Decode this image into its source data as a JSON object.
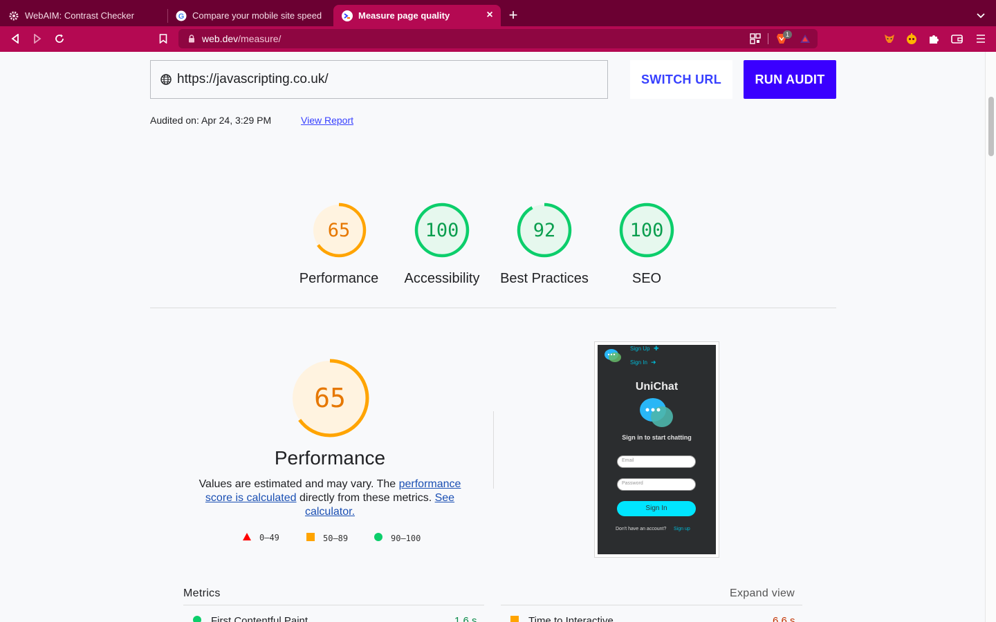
{
  "browser": {
    "tabs": [
      {
        "title": "WebAIM: Contrast Checker",
        "icon": "gear-favicon-icon"
      },
      {
        "title": "Compare your mobile site speed",
        "icon": "google-favicon-icon"
      },
      {
        "title": "Measure page quality",
        "icon": "webdev-favicon-icon",
        "active": true
      }
    ],
    "url_host": "web.dev",
    "url_path": "/measure/",
    "brave_badge": "1",
    "accent": "#b40952"
  },
  "audit": {
    "url_value": "https://javascripting.co.uk/",
    "switch_url_label": "SWITCH URL",
    "run_audit_label": "RUN AUDIT",
    "audited_on": "Audited on: Apr 24, 3:29 PM",
    "view_report": "View Report"
  },
  "scores": [
    {
      "label": "Performance",
      "score": "65",
      "value": 65,
      "color": "#ffa400",
      "bg": "#fff3e0"
    },
    {
      "label": "Accessibility",
      "score": "100",
      "value": 100,
      "color": "#0cce6b",
      "bg": "#e6f8ee"
    },
    {
      "label": "Best Practices",
      "score": "92",
      "value": 92,
      "color": "#0cce6b",
      "bg": "#e6f8ee"
    },
    {
      "label": "SEO",
      "score": "100",
      "value": 100,
      "color": "#0cce6b",
      "bg": "#e6f8ee"
    }
  ],
  "performance": {
    "score": "65",
    "value": 65,
    "title": "Performance",
    "desc_prefix": "Values are estimated and may vary. The ",
    "desc_link1": "performance score is calculated",
    "desc_middle": " directly from these metrics. ",
    "desc_link2": "See calculator.",
    "legend": [
      {
        "range": "0–49",
        "shape": "triangle",
        "color": "#ff0000"
      },
      {
        "range": "50–89",
        "shape": "square",
        "color": "#ffa400"
      },
      {
        "range": "90–100",
        "shape": "circle",
        "color": "#0cce6b"
      }
    ]
  },
  "screenshot": {
    "sign_up": "Sign Up",
    "sign_in_link": "Sign In",
    "app_name": "UniChat",
    "subtitle": "Sign in to start chatting",
    "email_placeholder": "Email",
    "password_placeholder": "Password",
    "sign_in_button": "Sign In",
    "no_account": "Don't have an account?",
    "sign_up_link": "Sign up",
    "accent": "#00e5ff"
  },
  "metrics": {
    "title": "Metrics",
    "expand_view": "Expand view",
    "items": [
      {
        "name": "First Contentful Paint",
        "value": "1.6 s",
        "status": "good"
      },
      {
        "name": "Time to Interactive",
        "value": "6.6 s",
        "status": "average"
      }
    ]
  }
}
